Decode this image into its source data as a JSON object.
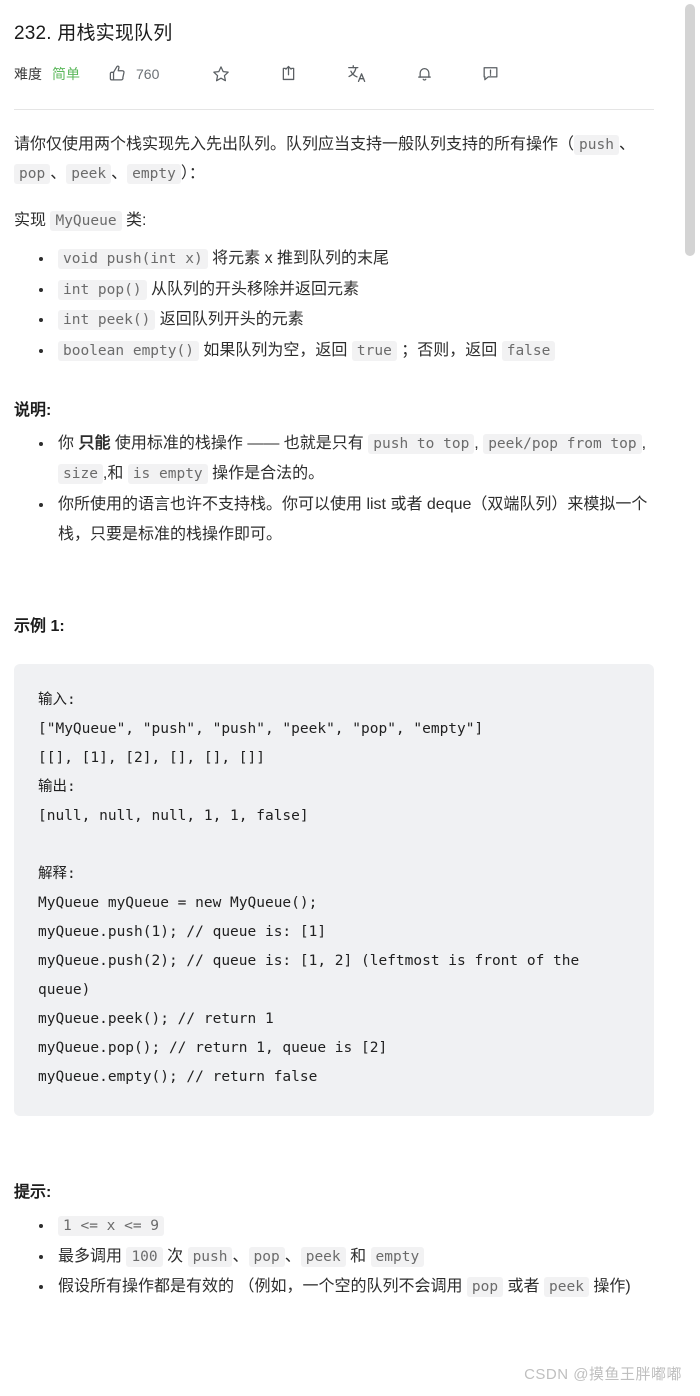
{
  "header": {
    "title": "232. 用栈实现队列",
    "difficulty_label": "难度",
    "difficulty_value": "简单",
    "like_count": "760",
    "icons": {
      "like": "thumbs-up-icon",
      "star": "star-icon",
      "share": "share-icon",
      "translate": "translate-icon",
      "bell": "bell-icon",
      "feedback": "feedback-icon"
    },
    "colors": {
      "difficulty": "#5cb85c",
      "icon": "#5a5f63",
      "divider": "#e5e5e5"
    }
  },
  "description": {
    "p1_a": "请你仅使用两个栈实现先入先出队列。队列应当支持一般队列支持的所有操作（",
    "p1_code1": "push",
    "p1_b": "、",
    "p1_code2": "pop",
    "p1_c": "、",
    "p1_code3": "peek",
    "p1_d": "、",
    "p1_code4": "empty",
    "p1_e": "）：",
    "p2_a": "实现",
    "p2_code": "MyQueue",
    "p2_b": "类:"
  },
  "methods": [
    {
      "code": "void push(int x)",
      "text": "将元素 x 推到队列的末尾"
    },
    {
      "code": "int pop()",
      "text": "从队列的开头移除并返回元素"
    },
    {
      "code": "int peek()",
      "text": "返回队列开头的元素"
    },
    {
      "code": "boolean empty()",
      "text": "如果队列为空，返回",
      "code2": "true",
      "text2": "；否则，返回",
      "code3": "false"
    }
  ],
  "notes": {
    "heading": "说明:",
    "item1": {
      "a": "你 ",
      "bold": "只能",
      "b": " 使用标准的栈操作 —— 也就是只有 ",
      "c1": "push to top",
      "c_sep1": ",",
      "c2": "peek/pop from top",
      "c_sep2": ",",
      "c3": "size",
      "d": ",和 ",
      "c4": "is empty",
      "e": " 操作是合法的。"
    },
    "item2": "你所使用的语言也许不支持栈。你可以使用 list 或者 deque（双端队列）来模拟一个栈，只要是标准的栈操作即可。"
  },
  "example": {
    "heading": "示例 1:",
    "code": "输入:\n[\"MyQueue\", \"push\", \"push\", \"peek\", \"pop\", \"empty\"]\n[[], [1], [2], [], [], []]\n输出:\n[null, null, null, 1, 1, false]\n\n解释:\nMyQueue myQueue = new MyQueue();\nmyQueue.push(1); // queue is: [1]\nmyQueue.push(2); // queue is: [1, 2] (leftmost is front of the queue)\nmyQueue.peek(); // return 1\nmyQueue.pop(); // return 1, queue is [2]\nmyQueue.empty(); // return false"
  },
  "hints": {
    "heading": "提示:",
    "item1_code": "1 <= x <= 9",
    "item2": {
      "a": "最多调用 ",
      "c1": "100",
      "b": " 次 ",
      "c2": "push",
      "sep1": "、",
      "c3": "pop",
      "sep2": "、",
      "c4": "peek",
      "c_and": " 和 ",
      "c5": "empty"
    },
    "item3": {
      "a": "假设所有操作都是有效的 （例如，一个空的队列不会调用 ",
      "c1": "pop",
      "b": " 或者 ",
      "c2": "peek",
      "c": " 操作)"
    }
  },
  "watermark": "CSDN @摸鱼王胖嘟嘟"
}
